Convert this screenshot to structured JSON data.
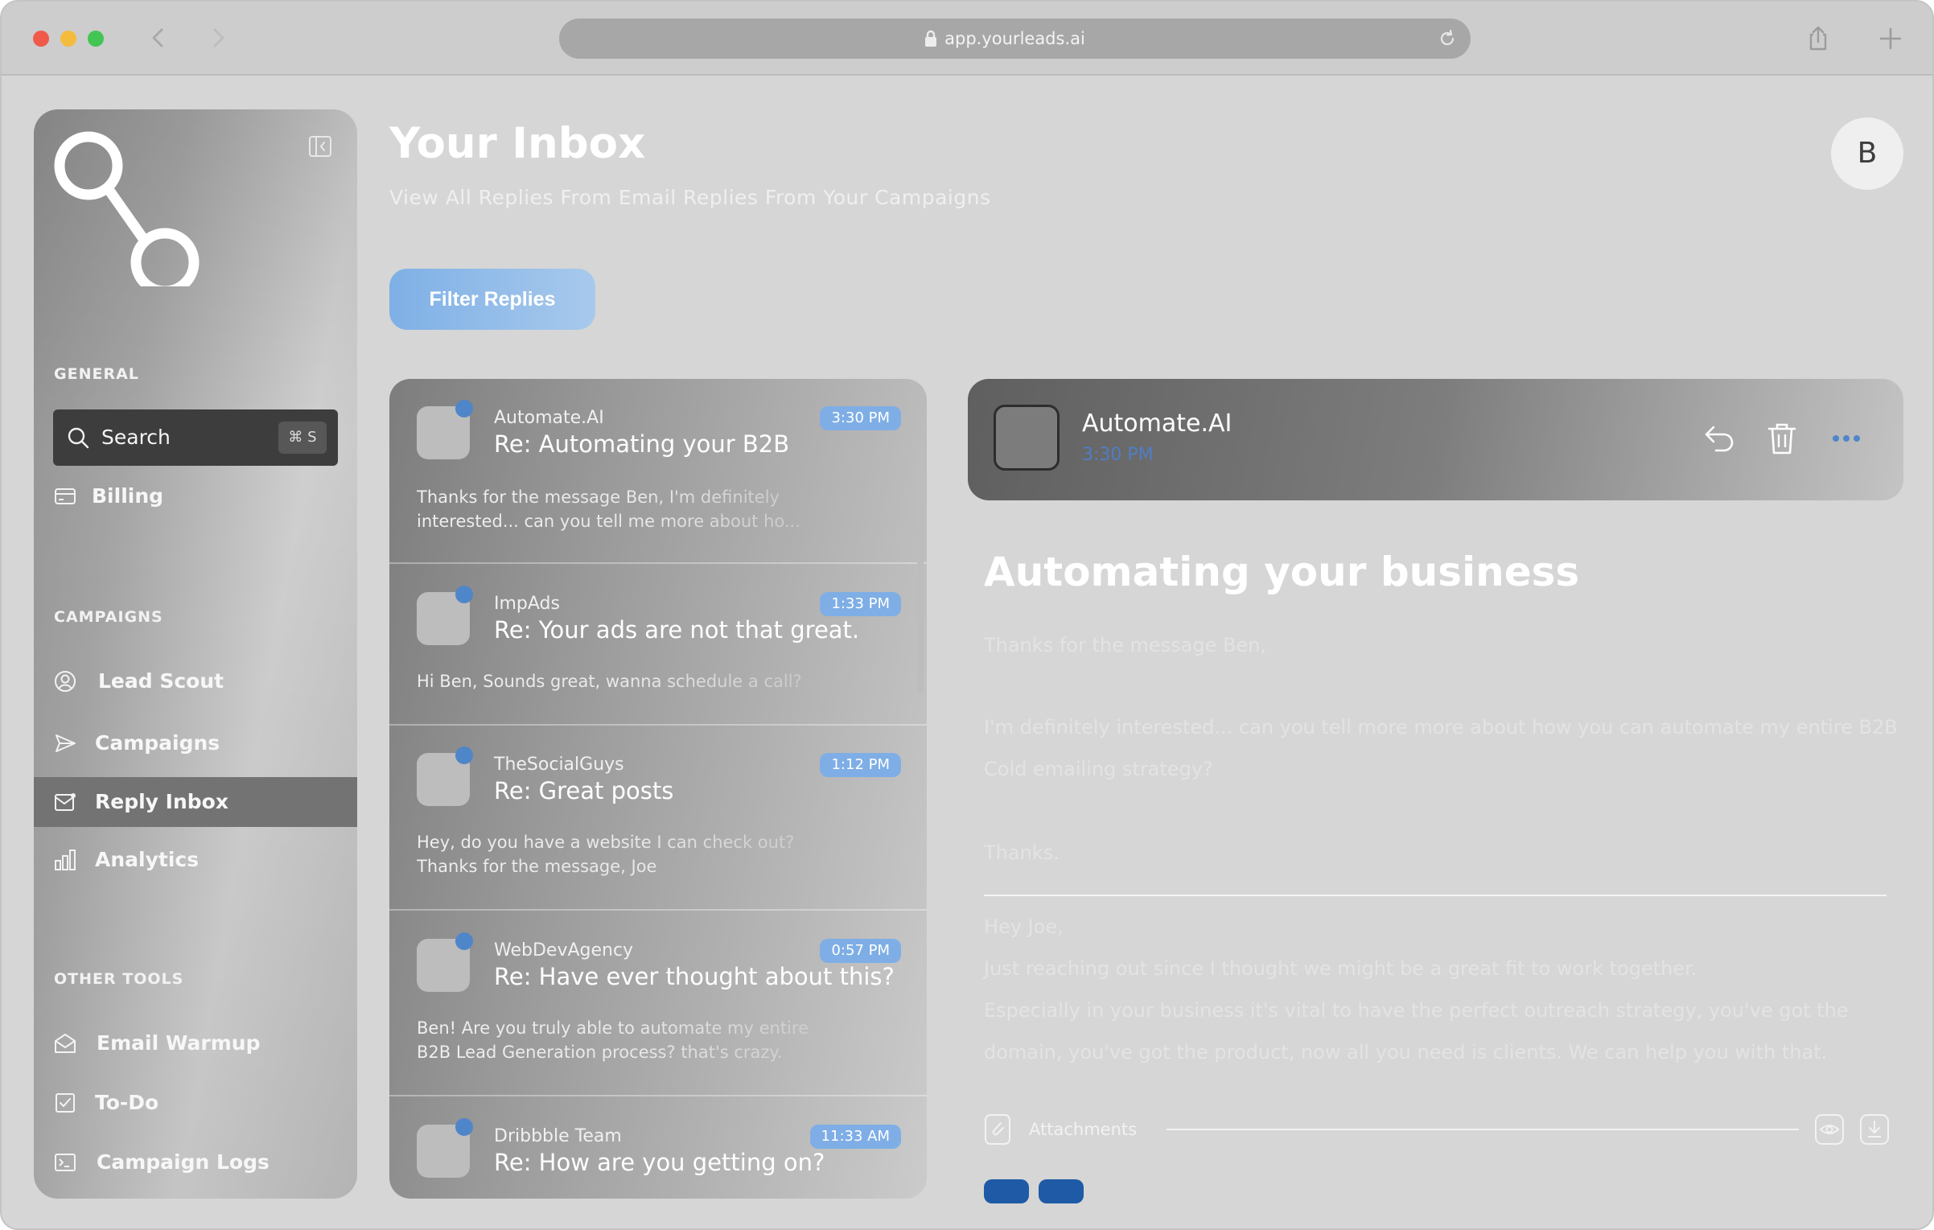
{
  "browser": {
    "url": "app.yourleads.ai"
  },
  "sidebar": {
    "sections": {
      "general": "GENERAL",
      "campaigns": "CAMPAIGNS",
      "other_tools": "OTHER TOOLS"
    },
    "search": {
      "label": "Search",
      "shortcut": "⌘ S"
    },
    "items": {
      "billing": "Billing",
      "lead_scout": "Lead Scout",
      "campaigns": "Campaigns",
      "reply_inbox": "Reply Inbox",
      "analytics": "Analytics",
      "email_warmup": "Email Warmup",
      "todo": "To-Do",
      "campaign_logs": "Campaign Logs"
    }
  },
  "header": {
    "title": "Your Inbox",
    "subtitle": "View All Replies From Email Replies From Your Campaigns",
    "avatar_initial": "B",
    "filter_button": "Filter Replies"
  },
  "messages": [
    {
      "sender": "Automate.AI",
      "subject": "Re: Automating your B2B",
      "time": "3:30 PM",
      "preview": "Thanks for the message Ben, I'm definitely interested... can you tell me more about ho..."
    },
    {
      "sender": "ImpAds",
      "subject": "Re: Your ads are not that great.",
      "time": "1:33 PM",
      "preview": "Hi Ben,  Sounds great, wanna schedule a call?"
    },
    {
      "sender": "TheSocialGuys",
      "subject": "Re: Great posts",
      "time": "1:12 PM",
      "preview": "Hey, do you have a website I can check out? Thanks for the message, Joe"
    },
    {
      "sender": "WebDevAgency",
      "subject": "Re: Have ever thought about this?",
      "time": "0:57 PM",
      "preview": "Ben! Are you truly able to automate my entire B2B Lead Generation process? that's crazy."
    },
    {
      "sender": "Dribbble Team",
      "subject": "Re: How are you getting on?",
      "time": "11:33 AM",
      "preview": ""
    }
  ],
  "reader": {
    "sender": "Automate.AI",
    "time": "3:30 PM",
    "title": "Automating your business",
    "body": [
      "Thanks for the message Ben,",
      "I'm definitely interested... can you tell more more about how you can automate my entire B2B",
      "Cold emailing strategy?",
      "Thanks."
    ],
    "quoted": [
      "Hey Joe,",
      "Just reaching out since I thought we might be a great fit to work together.",
      "Especially in your business it's vital to have the perfect outreach strategy, you've got the",
      "domain, you've got the product, now all you need is clients. We can help you with that."
    ],
    "attachments_label": "Attachments"
  },
  "colors": {
    "accent": "#7eaee5",
    "unread_dot": "#4f86c9",
    "active_nav": "#737373"
  }
}
